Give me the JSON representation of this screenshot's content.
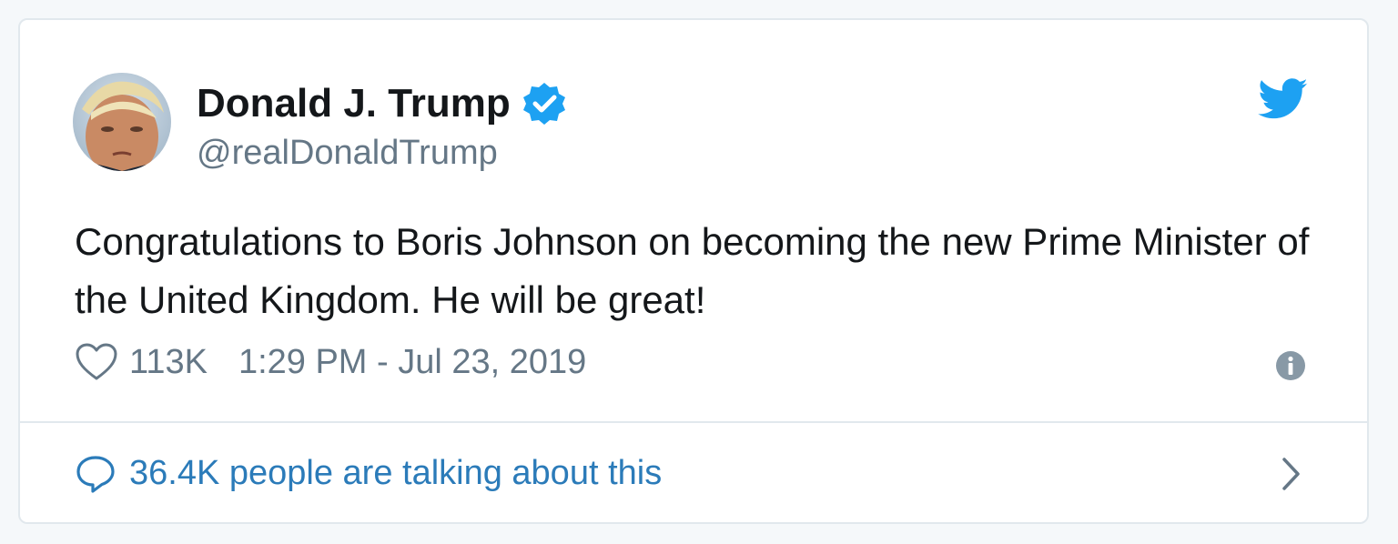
{
  "tweet": {
    "author": {
      "display_name": "Donald J. Trump",
      "handle": "@realDonaldTrump",
      "verified": true,
      "verified_icon": "verified-badge-icon",
      "avatar_icon": "avatar"
    },
    "brand_icon": "twitter-bird-icon",
    "text": "Congratulations to Boris Johnson on becoming the new Prime Minister of the United Kingdom. He will be great!",
    "likes": "113K",
    "like_icon": "heart-icon",
    "timestamp": "1:29 PM - Jul 23, 2019",
    "info_icon": "info-icon",
    "footer": {
      "label": "36.4K people are talking about this",
      "icon": "speech-bubble-icon",
      "chevron_icon": "chevron-right-icon"
    }
  },
  "colors": {
    "background": "#f5f8fa",
    "card": "#ffffff",
    "border": "#e1e8ed",
    "text_primary": "#14171a",
    "text_secondary": "#657786",
    "link": "#2b7bb9",
    "twitter_blue": "#1da1f2"
  }
}
